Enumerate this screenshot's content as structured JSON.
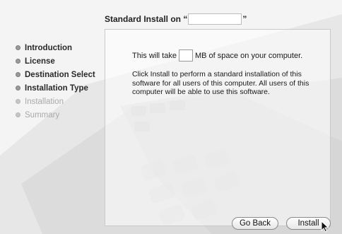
{
  "header": {
    "prefix": "Standard Install on “",
    "volume_name": "",
    "suffix": "”"
  },
  "sidebar": {
    "items": [
      {
        "label": "Introduction",
        "state": "done"
      },
      {
        "label": "License",
        "state": "done"
      },
      {
        "label": "Destination Select",
        "state": "done"
      },
      {
        "label": "Installation Type",
        "state": "current"
      },
      {
        "label": "Installation",
        "state": "pending"
      },
      {
        "label": "Summary",
        "state": "pending"
      }
    ]
  },
  "main": {
    "space_prefix": "This will take",
    "space_value": "",
    "space_suffix": "MB of space on your computer.",
    "body": "Click Install to perform a standard installation of this software for all users of this computer. All users of this computer will be able to use this software."
  },
  "buttons": {
    "back_label": "Go Back",
    "install_label": "Install"
  },
  "colors": {
    "background": "#f4f4f4",
    "panel_border": "#c9c9c9",
    "button_border": "#8a8a8a"
  }
}
